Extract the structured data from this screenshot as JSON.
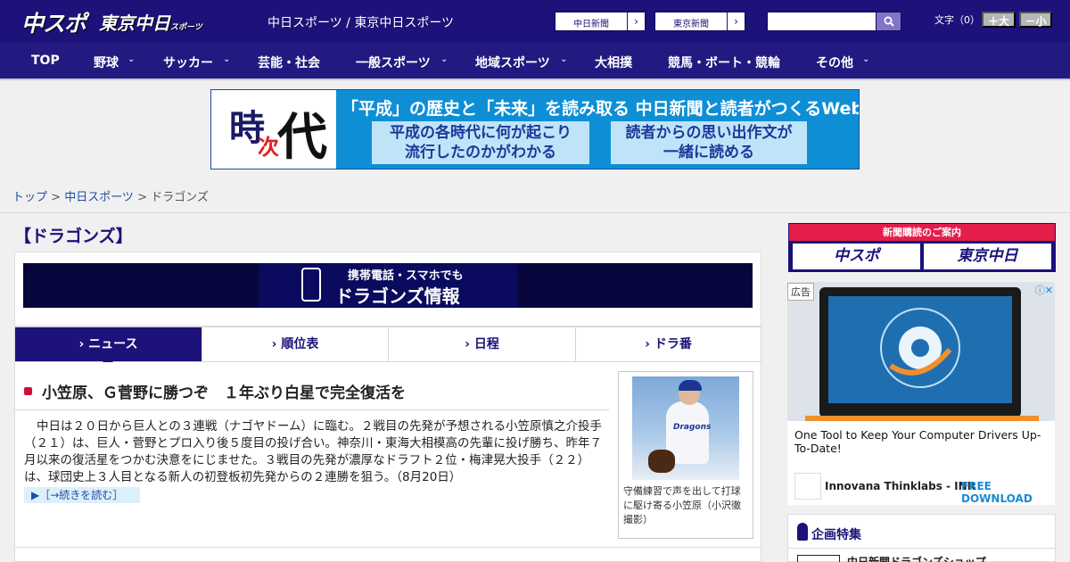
{
  "header": {
    "logo_chuspo": "中スポ",
    "logo_tokyo": "東京中日",
    "logo_tokyo_sub": "スポーツ",
    "site_links": "中日スポーツ / 東京中日スポーツ",
    "chunichi_btn": "中日新聞",
    "tokyo_btn": "東京新聞",
    "arrow": "›",
    "moji_label": "文字（0）",
    "size_up": "＋大",
    "size_down": "－小"
  },
  "nav": {
    "items": [
      "TOP",
      "野球",
      "サッカー",
      "芸能・社会",
      "一般スポーツ",
      "地域スポーツ",
      "大相撲",
      "競馬・ボート・競輪",
      "その他"
    ],
    "chevron": "⌄"
  },
  "banner": {
    "ji": "時",
    "tsugi": "次",
    "dai": "代",
    "headline": "「平成」の歴史と「未来」を読み取る 中日新聞と読者がつくるWebサイト",
    "left_l1": "平成の各時代に何が起こり",
    "left_l2": "流行したのかがわかる",
    "right_l1": "読者からの思い出作文が",
    "right_l2": "一緒に読める"
  },
  "breadcrumb": {
    "top": "トップ",
    "sep": " > ",
    "chunichi": "中日スポーツ",
    "current": "ドラゴンズ"
  },
  "page": {
    "title": "【ドラゴンズ】",
    "mobile_l1": "携帯電話・スマホでも",
    "mobile_l2": "ドラゴンズ情報"
  },
  "tabs": [
    {
      "label": "› ニュース"
    },
    {
      "label": "› 順位表"
    },
    {
      "label": "› 日程"
    },
    {
      "label": "› ドラ番"
    }
  ],
  "article": {
    "headline": "小笠原、Ｇ菅野に勝つぞ　１年ぶり白星で完全復活を",
    "body": "中日は２０日から巨人との３連戦（ナゴヤドーム）に臨む。２戦目の先発が予想される小笠原慎之介投手（２１）は、巨人・菅野とプロ入り後５度目の投げ合い。神奈川・東海大相模高の先輩に投げ勝ち、昨年７月以来の復活星をつかむ決意をにじませた。３戦目の先発が濃厚なドラフト２位・梅津晃大投手（２２）は、球団史上３人目となる新人の初登板初先発からの２連勝を狙う。（8月20日）",
    "more": "▶［→続きを読む］",
    "photo_caption": "守備練習で声を出して打球に駆け寄る小笠原（小沢徹撮影）",
    "uniform": "Dragons"
  },
  "sidebar": {
    "subscribe_title": "新聞購読のご案内",
    "sub_chuspo": "中スポ",
    "sub_tokyo": "東京中日",
    "ad_label": "広告",
    "ad_close": "ⓘ✕",
    "ad_text": "One Tool to Keep Your Computer Drivers Up-To-Date!",
    "ad_company": "Innovana Thinklabs - INR",
    "ad_cta": "FREE DOWNLOAD",
    "kikaku_title": "企画特集",
    "kikaku_item": "中日新聞ドラゴンズショップ"
  },
  "colors": {
    "header_navy": "#1c1279",
    "nav_navy": "#221a80",
    "accent_red": "#e41d4b",
    "link_blue": "#1c4fa0"
  }
}
